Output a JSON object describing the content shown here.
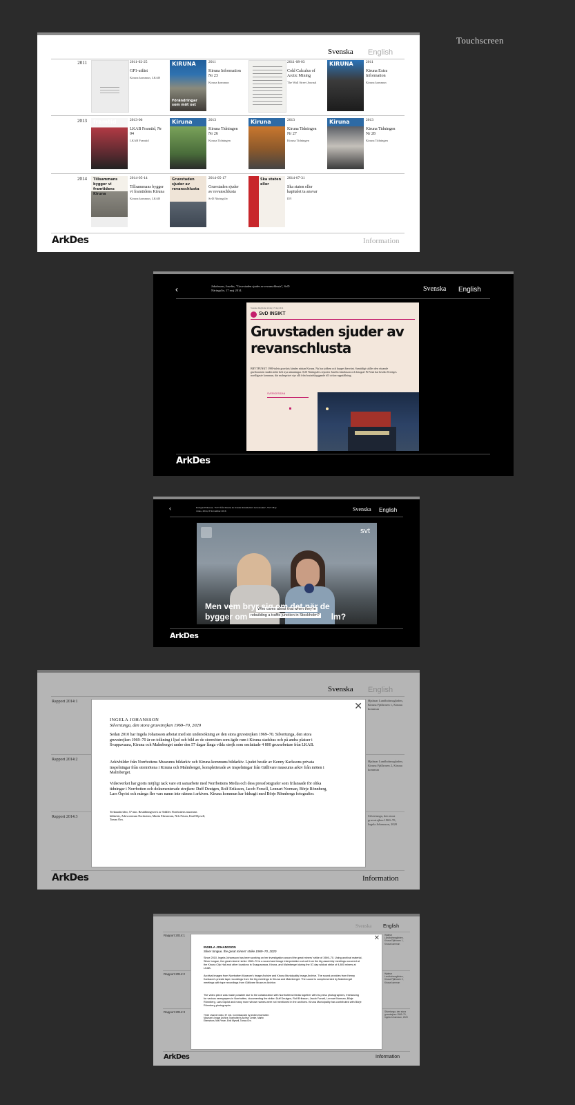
{
  "touch_label": "Touchscreen",
  "lang": {
    "sv": "Svenska",
    "en": "English"
  },
  "logo": "ArkDes",
  "info": "Information",
  "grid": {
    "rows": [
      {
        "year": "2011",
        "items": [
          {
            "date": "2011-02-25",
            "title": "GP1-utfäst",
            "source": "Kiruna kommun, LKAB",
            "cover": "doc"
          },
          {
            "date": "2011",
            "title": "Kiruna Information Nr 23",
            "source": "Kiruna kommun",
            "cover": "kiruna-blue",
            "cover_text": "KIRUNA",
            "cover_sub": "Förändringar som möt ost"
          },
          {
            "date": "2011-08-03",
            "title": "Cold Calculus of Arctic Mining",
            "source": "The Wall Street Journal",
            "cover": "newspaper"
          },
          {
            "date": "2011",
            "title": "Kiruna Extra Information",
            "source": "Kiruna kommun",
            "cover": "kiruna-dark",
            "cover_text": "KIRUNA"
          }
        ]
      },
      {
        "year": "2013",
        "items": [
          {
            "date": "2013-06",
            "title": "LKAB Framtid, Nr 04",
            "source": "LKAB Framtid",
            "cover": "framtid",
            "cover_text": "framtid"
          },
          {
            "date": "2013",
            "title": "Kiruna Tidningen Nr 26",
            "source": "Kiruna Tidningen",
            "cover": "kt-green",
            "cover_text": "Kiruna"
          },
          {
            "date": "2013",
            "title": "Kiruna Tidningen Nr 27",
            "source": "Kiruna Tidningen",
            "cover": "kt-orange",
            "cover_text": "Kiruna"
          },
          {
            "date": "2013",
            "title": "Kiruna Tidningen Nr 28",
            "source": "Kiruna Tidningen",
            "cover": "kt-man",
            "cover_text": "Kiruna"
          }
        ]
      },
      {
        "year": "2014",
        "items": [
          {
            "date": "2014-05-14",
            "title": "Tillsammans bygger vi framtidens Kiruna",
            "source": "Kiruna kommun, LKAB",
            "cover": "together",
            "cover_text": "Tillsammans bygger vi framtidens Kiruna"
          },
          {
            "date": "2014-05-17",
            "title": "Gruvstaden sjuder av revanschlusta",
            "source": "SvD Näringsliv",
            "cover": "svd",
            "cover_text": "Gruvstaden sjuder av revanschlusta"
          },
          {
            "date": "2014-07-31",
            "title": "Ska staten eller kapitalet ta ansvar",
            "source": "DN",
            "cover": "red",
            "cover_text": "Ska staten eller"
          }
        ]
      }
    ]
  },
  "article": {
    "caption": "Jakobsson, Josefin, \"Gruvstaden sjuder av revanschlusta\", SvD Näringsliv, 17 maj 2014.",
    "kicker": "SvD INSIKT",
    "head": "Gruvstaden sjuder av revanschlusta",
    "ingress": "BRYTPUNKT 1980-talets gruvkris kändes nästan Kiruna. Nu har jobben och hoppet återvänt. Samtidigt ställer den växande gruvboomen staden inför helt nya utmaningar. SvD Näringslivs reporter Josefin Jakobsson och fotograf Pi Frisk har besökt Sveriges nordligaste kommun, där malmpriset styr allt från bostadsbyggande till cirkus-uppställning.",
    "topline": "Svenska Dagbladet lördag 17 maj 2014",
    "inset_title": "SVERIGESIDAN"
  },
  "video": {
    "caption": "Kerigan Eriksson, \"SVT från Kiruna & Ivanka Rönnholm's Gruvstaden\", SVT Play video, 2014, 8 November 2016",
    "brand": "svt",
    "subtitle_sv_1": "Men vem bryr sig om det när de",
    "subtitle_sv_2": "bygger om",
    "subtitle_sv_end": "lm?",
    "subtitle_en_1": "Who cares about that when they're",
    "subtitle_en_2": "rebuilding a traffic junction in Stockholm?"
  },
  "reports": [
    {
      "label": "Rapport 2014:1",
      "side": "Hjalmar Lundbohmsgården, Kiruna Fjällrosen 1, Kiruna kommun"
    },
    {
      "label": "Rapport 2014:2",
      "side": "Hjalmar Lundbohmsgården, Kiruna Fjällrosen 2, Kiruna kommun"
    },
    {
      "label": "Rapport 2014:3",
      "side": "Silvertunga, den stora gruvstrejken 1969–70, Ingela Johansson, 2020"
    }
  ],
  "modal_sv": {
    "author": "INGELA JOHANSSON",
    "work": "Silvertunga, den stora gruvstrejken 1969–70, 2020",
    "p1": "Sedan 2010 har Ingela Johansson arbetat med sin undersökning av den stora gruvstrejken 1969–70. Silvertunga, den stora gruvstrejken 1969–70 är en tolkning i ljud och bild av de stormöten som ägde rum i Kiruna stadshus och på andra platser i Svappavaara, Kiruna och Malmberget under den 57 dagar långa vilda strejk som omfattade 4 800 gruvarbetare från LKAB.",
    "p2": "Arkivbilder från Norrbottens Museums bildarkiv och Kiruna kommuns bildarkiv. Ljudet består av Kenny Karlssons privata inspelningar från stormötena i Kiruna och Malmberget, kompletterade av inspelningar från Gällivare museums arkiv från möten i Malmberget.",
    "p3": "Videoverket har gjorts möjligt tack vare ett samarbete med Norrbottens Media och dess pressfotografer som frilansade för olika tidningar i Norrbotten och dokumenterade strejken: Duff Deutgen, Rolf Eriksson, Jacob Forsell, Lennart Norman, Börje Rönnberg, Lars Öqvist och många fler vars namn inte nämns i arkiven. Kiruna kommun har bidragit med Börje Rönnbergs fotografier.",
    "credits": "Trekanalsvideo, 57 min. Beställningsverk av ArkDes Norrbottens museums bildarkiv, Arkivcentrum Norrbotten, Martin Ebenstrom, Nils Frisen, Emil Myrsell, Tomas Örn."
  },
  "modal_en": {
    "author": "INGELA JOHANSSON",
    "work": "Silver tongue, the great miners' strike 1969–70, 2020",
    "p1": "Since 2010, Ingela Johansson has been working on her investigation around the great miners' strike of 1969–70. Using archival material, Silver tongue, the great miners' strike 1969–70 is a sound and image interpretation cut out from the big assembly meetings occurred at the Kiruna City Hall and other locations in Svappavaara, Kiruna, and Malmberget during the 57-day wildcat strike of 4,800 miners at LKAB.",
    "p2": "Archival images from Norrbotten Museum's Image Archive and Kiruna Municipality Image Archive. The sound provides from Kenny Karlsson's private tape recordings from the big meetings in Kiruna and Malmberget. The sound is complemented by Malmberget meetings with tape recordings from Gällivare Museum Archive.",
    "p3": "The video piece was made possible due to the collaboration with Norrbottens Media together with its press photographers, freelancing for various newspapers in Norrbotten, documenting the strike: Duff Deutgen, Rolf Eriksson, Jacob Forsell, Lennart Norman, Börje Rönnberg, Lars Öqvist and many more whose names were not mentioned in the archives. Kiruna Municipality has contributed with Börje Rönnberg photographs.",
    "credits": "Three channel video, 57 min. Commissioned by ArkDes Norrbotten Museum's Image Archive, Norrbotten's Archive Centre, Martin Ebenstrom, Nils Frisen, Emil Myrsell, Tomas Örn."
  }
}
